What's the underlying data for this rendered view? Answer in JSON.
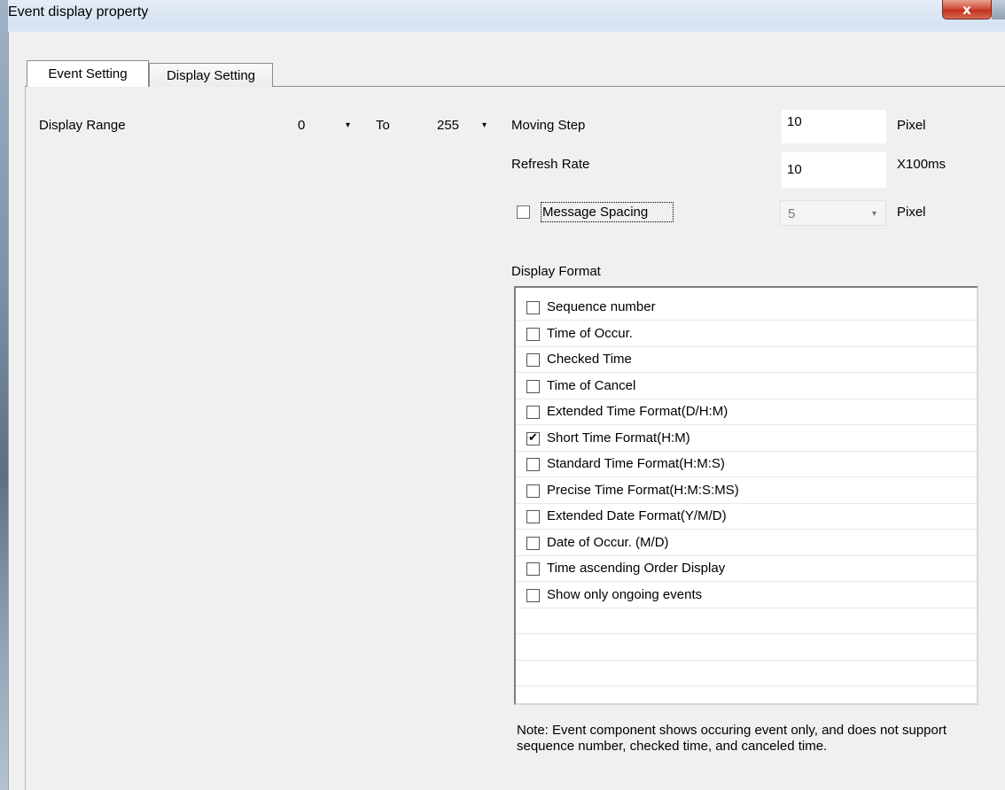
{
  "window": {
    "title": "Event display property",
    "close_glyph": "x"
  },
  "tabs": [
    {
      "label": "Event Setting",
      "active": true
    },
    {
      "label": "Display Setting",
      "active": false
    }
  ],
  "display_range": {
    "label": "Display Range",
    "from_value": "0",
    "to_label": "To",
    "to_value": "255"
  },
  "moving_step": {
    "label": "Moving Step",
    "value": "10",
    "unit": "Pixel"
  },
  "refresh_rate": {
    "label": "Refresh Rate",
    "value": "10",
    "unit": "X100ms"
  },
  "message_spacing": {
    "label": "Message Spacing",
    "checked": false,
    "value": "5",
    "unit": "Pixel"
  },
  "display_format": {
    "label": "Display Format",
    "items": [
      {
        "label": "Sequence number",
        "checked": false
      },
      {
        "label": "Time of Occur.",
        "checked": false
      },
      {
        "label": "Checked Time",
        "checked": false
      },
      {
        "label": "Time of Cancel",
        "checked": false
      },
      {
        "label": "Extended Time Format(D/H:M)",
        "checked": false
      },
      {
        "label": "Short Time Format(H:M)",
        "checked": true
      },
      {
        "label": "Standard Time Format(H:M:S)",
        "checked": false
      },
      {
        "label": "Precise Time Format(H:M:S:MS)",
        "checked": false
      },
      {
        "label": "Extended Date Format(Y/M/D)",
        "checked": false
      },
      {
        "label": "Date of Occur.  (M/D)",
        "checked": false
      },
      {
        "label": "Time ascending Order Display",
        "checked": false
      },
      {
        "label": "Show only ongoing events",
        "checked": false
      }
    ]
  },
  "note": "Note: Event component shows occuring event only, and does not support sequence number, checked time, and canceled time.",
  "icons": {
    "dropdown": "▾",
    "check": "✔"
  }
}
